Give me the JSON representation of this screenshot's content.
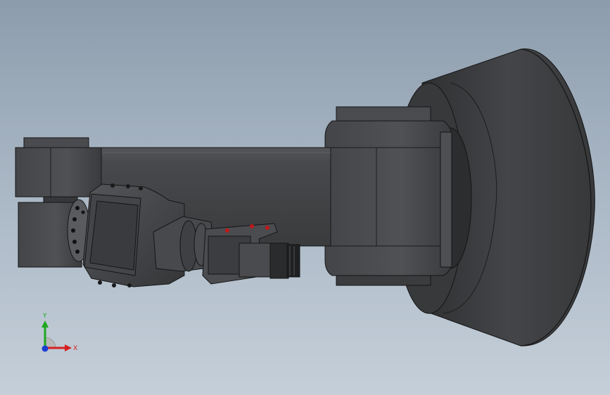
{
  "viewport": {
    "background_top": "#8d9cac",
    "background_bottom": "#c5cfd9"
  },
  "model": {
    "body_color": "#3e3f41",
    "edge_color": "#1a1a1a",
    "highlight_color": "#5a5b5e",
    "accent_color": "#c01818"
  },
  "triad": {
    "x_label": "X",
    "y_label": "Y",
    "x_color": "#d62020",
    "y_color": "#1fa81f",
    "z_color": "#1c3fcf"
  }
}
